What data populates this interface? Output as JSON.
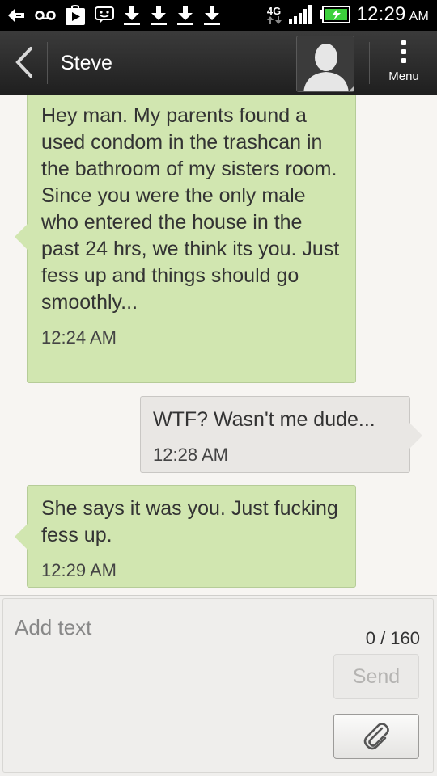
{
  "status_bar": {
    "network": "4G",
    "time": "12:29",
    "ampm": "AM"
  },
  "header": {
    "title": "Steve",
    "menu_label": "Menu"
  },
  "messages": [
    {
      "direction": "incoming",
      "text": "Hey man. My parents found a used condom in the trashcan in the bathroom of my sisters room. Since you were the only male who entered the house in the past 24 hrs, we think its you. Just fess up and things should go smoothly...",
      "time": "12:24 AM"
    },
    {
      "direction": "outgoing",
      "text": "WTF? Wasn't me dude...",
      "time": "12:28 AM"
    },
    {
      "direction": "incoming",
      "text": "She says it was you. Just fucking fess up.",
      "time": "12:29 AM"
    }
  ],
  "composer": {
    "placeholder": "Add text",
    "counter": "0 / 160",
    "send_label": "Send"
  },
  "icons": [
    "back-arrow-icon",
    "contact-avatar-icon",
    "overflow-menu-icon",
    "paperclip-icon",
    "voicemail-icon",
    "play-store-icon",
    "chat-icon",
    "download-icon",
    "signal-icon",
    "battery-icon"
  ],
  "colors": {
    "incoming_bubble": "#d1e6b0",
    "outgoing_bubble": "#e9e7e4",
    "header_bg": "#2a2a2a",
    "status_bar_bg": "#000000",
    "battery_green": "#3cd13c"
  }
}
